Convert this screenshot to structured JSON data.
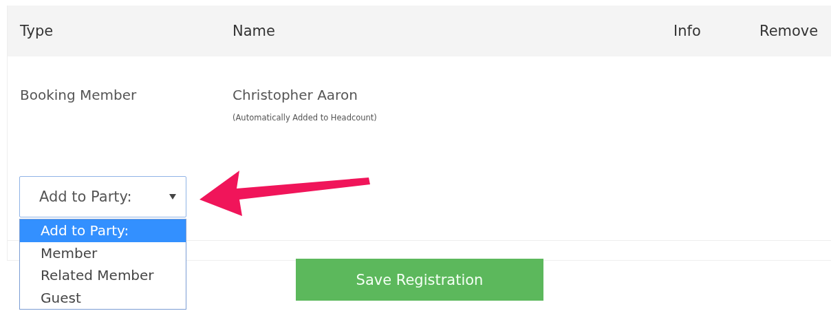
{
  "table": {
    "columns": [
      "Type",
      "Name",
      "Info",
      "Remove"
    ],
    "rows": [
      {
        "type": "Booking Member",
        "name": "Christopher Aaron",
        "note": "(Automatically Added to Headcount)"
      }
    ]
  },
  "party_select": {
    "value": "Add to Party:",
    "expanded": true,
    "options": [
      {
        "label": "Add to Party:",
        "selected": true
      },
      {
        "label": "Member",
        "selected": false
      },
      {
        "label": "Related Member",
        "selected": false
      },
      {
        "label": "Guest",
        "selected": false
      }
    ]
  },
  "save_button": "Save Registration"
}
